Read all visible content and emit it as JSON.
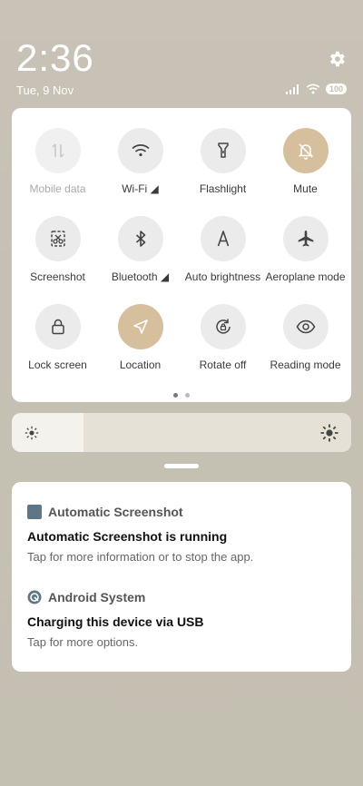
{
  "status_bar": {
    "time": "2:36",
    "date": "Tue, 9 Nov",
    "battery": "100"
  },
  "toggles": [
    {
      "label": "Mobile data",
      "icon": "mobile-data-icon",
      "state": "disabled"
    },
    {
      "label": "Wi-Fi ◢",
      "icon": "wifi-icon",
      "state": "off"
    },
    {
      "label": "Flashlight",
      "icon": "flashlight-icon",
      "state": "off"
    },
    {
      "label": "Mute",
      "icon": "bell-off-icon",
      "state": "on"
    },
    {
      "label": "Screenshot",
      "icon": "screenshot-icon",
      "state": "off"
    },
    {
      "label": "Bluetooth ◢",
      "icon": "bluetooth-icon",
      "state": "off"
    },
    {
      "label": "Auto brightness",
      "icon": "auto-brightness-icon",
      "state": "off"
    },
    {
      "label": "Aeroplane mode",
      "icon": "airplane-icon",
      "state": "off"
    },
    {
      "label": "Lock screen",
      "icon": "lock-icon",
      "state": "off"
    },
    {
      "label": "Location",
      "icon": "location-icon",
      "state": "on"
    },
    {
      "label": "Rotate off",
      "icon": "rotate-lock-icon",
      "state": "off"
    },
    {
      "label": "Reading mode",
      "icon": "eye-icon",
      "state": "off"
    }
  ],
  "brightness": {
    "level": 0.21
  },
  "notifications": [
    {
      "app": "Automatic Screenshot",
      "title": "Automatic Screenshot is running",
      "text": "Tap for more information or to stop the app."
    },
    {
      "app": "Android System",
      "title": "Charging this device via USB",
      "text": "Tap for more options."
    }
  ],
  "colors": {
    "accent": "#d6bf9c",
    "background": "#c5c0b3"
  }
}
